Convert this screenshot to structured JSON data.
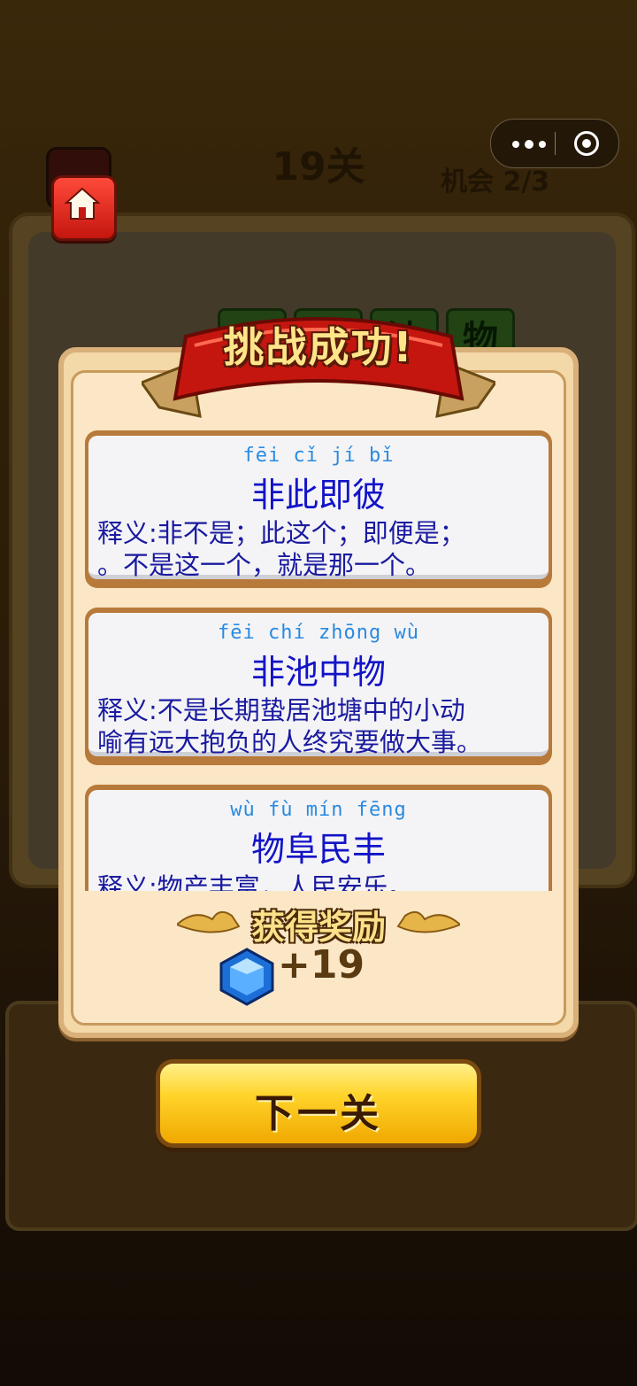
{
  "header": {
    "level": "19关",
    "chance_label": "机会",
    "chance_value": "2/3"
  },
  "board": {
    "tiles": [
      "池",
      "物"
    ]
  },
  "modal": {
    "title": "挑战成功!",
    "idioms": [
      {
        "pinyin": "fēi cǐ jí bǐ",
        "word": "非此即彼",
        "meaning_line1": "释义:非不是；此这个；即便是；",
        "meaning_line2": "。不是这一个，就是那一个。"
      },
      {
        "pinyin": "fēi chí zhōng wù",
        "word": "非池中物",
        "meaning_line1": "释义:不是长期蛰居池塘中的小动",
        "meaning_line2": "喻有远大抱负的人终究要做大事。"
      },
      {
        "pinyin": "wù fù mín fēng",
        "word": "物阜民丰",
        "meaning_line1": "释义:物产丰富，人民安乐。",
        "meaning_line2": ""
      }
    ],
    "reward_label": "获得奖励",
    "reward_amount": "+19",
    "reward_icon": "diamond-gem-icon"
  },
  "next_button": "下一关",
  "colors": {
    "pinyin": "#2a8ae0",
    "word": "#1313c8",
    "button": "#ffd42a",
    "banner": "#c4160f"
  }
}
